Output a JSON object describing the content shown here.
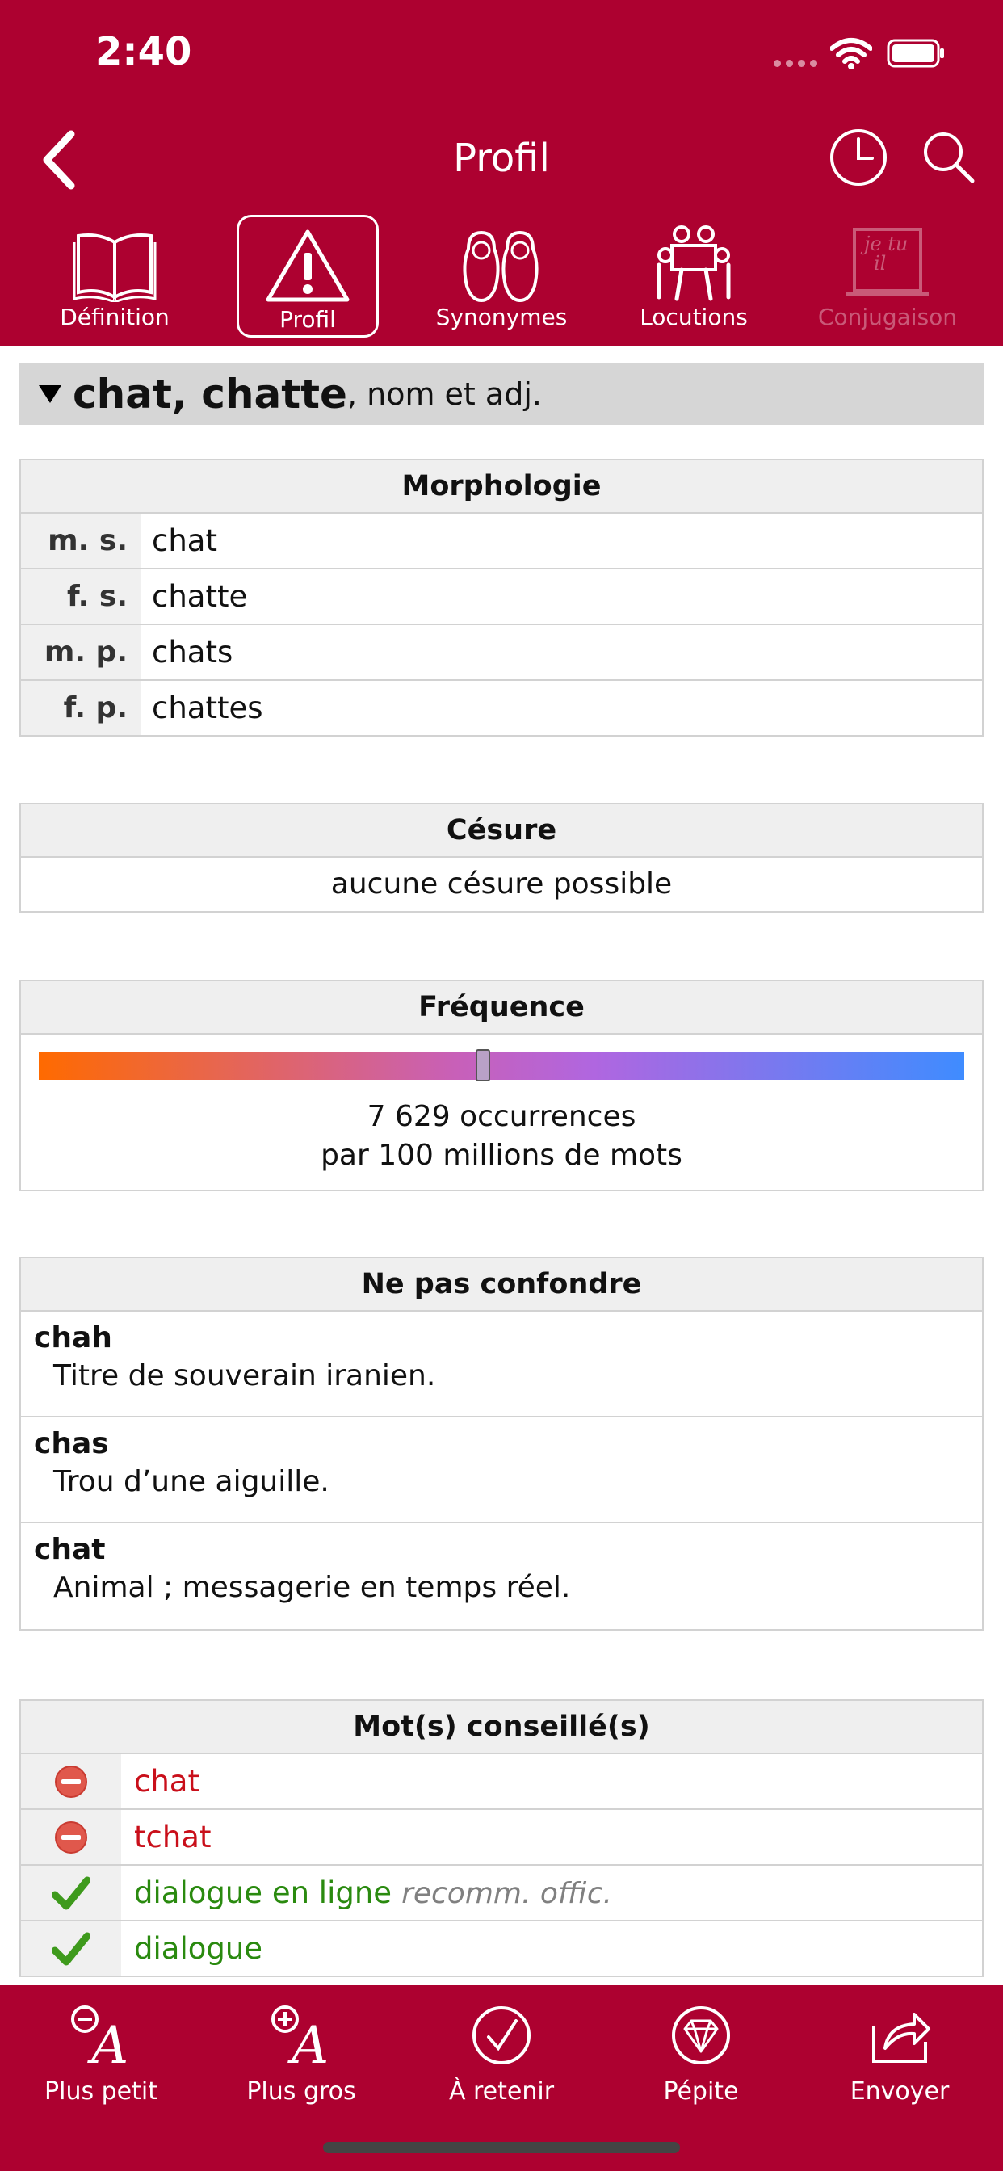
{
  "status_bar": {
    "time": "2:40"
  },
  "nav": {
    "title": "Profil"
  },
  "tabs": [
    {
      "label": "Définition",
      "icon": "book-icon",
      "active": false,
      "disabled": false
    },
    {
      "label": "Profil",
      "icon": "warning-icon",
      "active": true,
      "disabled": false
    },
    {
      "label": "Synonymes",
      "icon": "matryoshka-icon",
      "active": false,
      "disabled": false
    },
    {
      "label": "Locutions",
      "icon": "people-group-icon",
      "active": false,
      "disabled": false
    },
    {
      "label": "Conjugaison",
      "icon": "chalkboard-icon",
      "active": false,
      "disabled": true
    }
  ],
  "entry": {
    "headword": "chat, chatte",
    "pos": ", nom et adj."
  },
  "morphologie": {
    "title": "Morphologie",
    "rows": [
      {
        "key": "m. s.",
        "value": "chat"
      },
      {
        "key": "f. s.",
        "value": "chatte"
      },
      {
        "key": "m. p.",
        "value": "chats"
      },
      {
        "key": "f. p.",
        "value": "chattes"
      }
    ]
  },
  "cesure": {
    "title": "Césure",
    "value": "aucune césure possible"
  },
  "frequence": {
    "title": "Fréquence",
    "line1": "7 629 occurrences",
    "line2": "par 100 millions de mots",
    "marker_fraction": 0.48,
    "gradient_colors": [
      "#ff6a00",
      "#c860b8",
      "#b066e0",
      "#3f8cff"
    ]
  },
  "confondre": {
    "title": "Ne pas confondre",
    "items": [
      {
        "word": "chah",
        "definition": "Titre de souverain iranien."
      },
      {
        "word": "chas",
        "definition": "Trou d’une aiguille."
      },
      {
        "word": "chat",
        "definition": "Animal ; messagerie en temps réel."
      }
    ]
  },
  "conseilles": {
    "title": "Mot(s) conseillé(s)",
    "rows": [
      {
        "word": "chat",
        "status": "discouraged",
        "icon": "minus-circle-icon",
        "note": ""
      },
      {
        "word": "tchat",
        "status": "discouraged",
        "icon": "minus-circle-icon",
        "note": ""
      },
      {
        "word": "dialogue en ligne",
        "status": "recommended",
        "icon": "checkmark-icon",
        "note": "recomm. offic."
      },
      {
        "word": "dialogue",
        "status": "recommended",
        "icon": "checkmark-icon",
        "note": ""
      }
    ]
  },
  "toolbar": {
    "smaller": "Plus petit",
    "bigger": "Plus gros",
    "remember": "À retenir",
    "gem": "Pépite",
    "send": "Envoyer"
  },
  "colors": {
    "brand": "#ad0130",
    "bad": "#c90f1a",
    "good": "#2a8a0f"
  }
}
